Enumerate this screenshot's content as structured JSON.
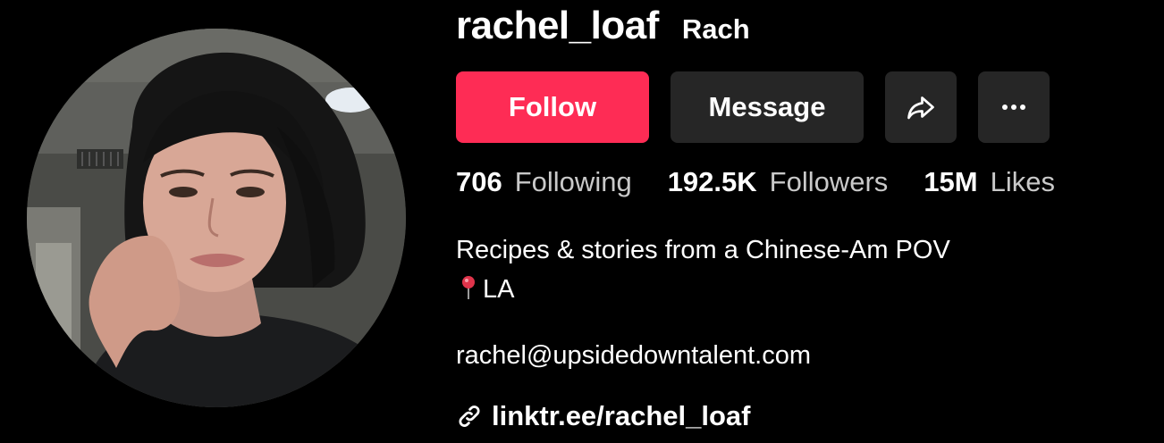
{
  "profile": {
    "username": "rachel_loaf",
    "nickname": "Rach",
    "avatar_icon": "profile-photo"
  },
  "actions": {
    "follow_label": "Follow",
    "message_label": "Message",
    "share_icon": "share-arrow-icon",
    "more_icon": "more-dots-icon"
  },
  "stats": [
    {
      "value": "706",
      "label": "Following"
    },
    {
      "value": "192.5K",
      "label": "Followers"
    },
    {
      "value": "15M",
      "label": "Likes"
    }
  ],
  "bio": {
    "line1": "Recipes & stories from a Chinese-Am POV",
    "line2_icon": "round-pushpin-icon",
    "line2": "LA",
    "email": "rachel@upsidedowntalent.com"
  },
  "link": {
    "icon": "link-icon",
    "text": "linktr.ee/rachel_loaf"
  },
  "colors": {
    "background": "#000000",
    "follow": "#fe2c55",
    "secondary_button": "#262626",
    "muted_text": "#c9c9c9"
  }
}
